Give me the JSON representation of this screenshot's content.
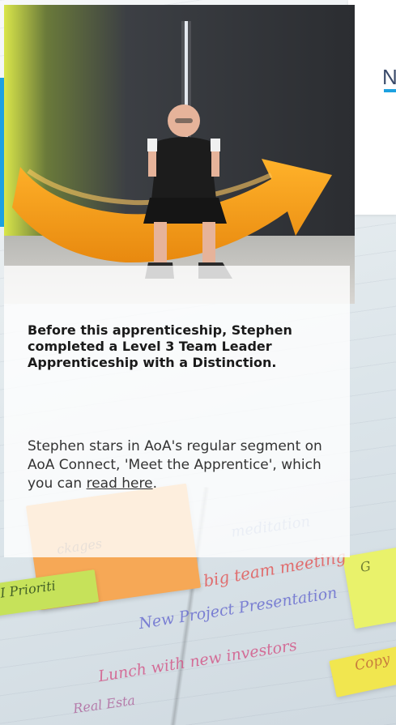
{
  "side_panel": {
    "heading_fragment": "N"
  },
  "card": {
    "heading": "Before this apprenticeship, Stephen completed a Level 3 Team Leader Apprenticeship with a Distinction.",
    "body_before_link": "Stephen stars in AoA's regular segment on AoA Connect, 'Meet the Apprentice', which you can ",
    "link_text": "read here",
    "body_after_link": "."
  },
  "background_notes": {
    "note_1": "big team meeting",
    "note_2": "New Project Presentation",
    "note_3": "Lunch with new investors",
    "note_4": "Real Esta",
    "note_5": "I Prioriti",
    "note_6": "meditation",
    "note_7": "ckages",
    "note_8": "Copy",
    "note_9": "G"
  },
  "colors": {
    "accent": "#1da1e0",
    "arrow": "#f5a11c",
    "sticky_orange": "#f6a856",
    "sticky_green": "#c6e25a"
  }
}
